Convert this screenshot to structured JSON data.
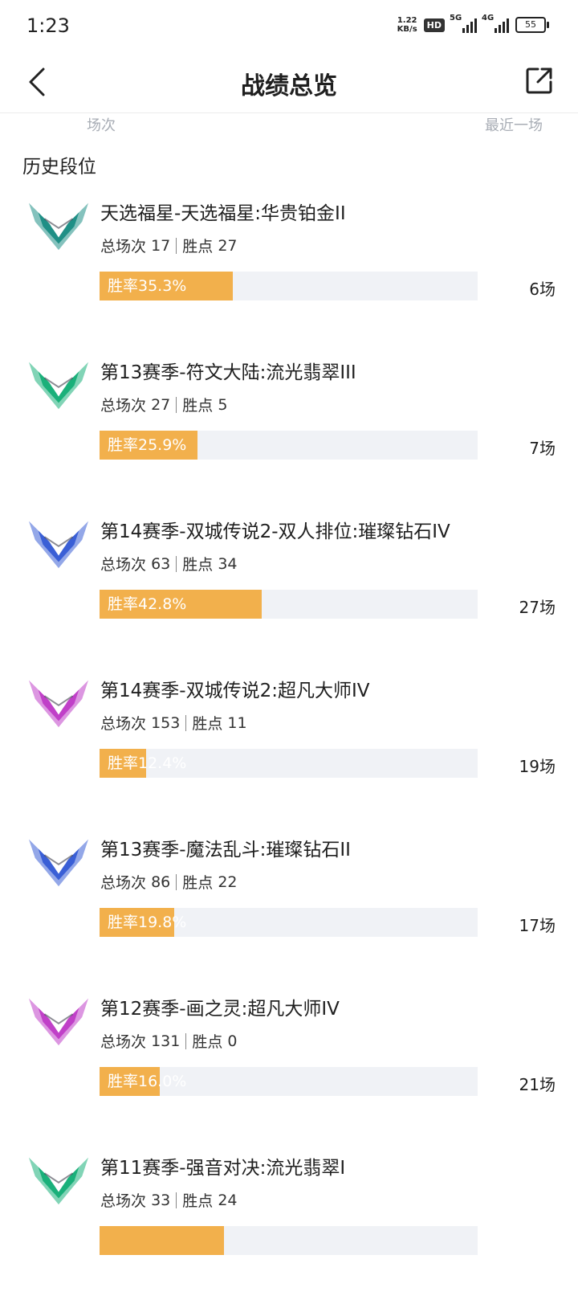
{
  "status_bar": {
    "time": "1:23",
    "net_speed_value": "1.22",
    "net_speed_unit": "KB/s",
    "hd_badge": "HD",
    "signal1_label": "5G",
    "signal2_label": "4G",
    "battery": "55"
  },
  "nav": {
    "title": "战绩总览",
    "back_icon": "chevron-left-icon",
    "share_icon": "share-external-icon"
  },
  "sub_header": {
    "left": "场次",
    "right": "最近一场"
  },
  "section_title": "历史段位",
  "colors": {
    "accent_orange": "#f2b04c",
    "track_gray": "#f0f2f6",
    "emerald": "#1ab07a",
    "platinum": "#1f8f86",
    "diamond": "#3a5fd6",
    "master": "#c040c8"
  },
  "ranks": [
    {
      "name": "天选福星-天选福星:华贵铂金II",
      "total_label": "总场次",
      "total": "17",
      "points_label": "胜点",
      "points": "27",
      "rate_text": "胜率35.3%",
      "rate": 35.3,
      "count": "6场",
      "tier": "platinum"
    },
    {
      "name": "第13赛季-符文大陆:流光翡翠III",
      "total_label": "总场次",
      "total": "27",
      "points_label": "胜点",
      "points": "5",
      "rate_text": "胜率25.9%",
      "rate": 25.9,
      "count": "7场",
      "tier": "emerald"
    },
    {
      "name": "第14赛季-双城传说2-双人排位:璀璨钻石IV",
      "total_label": "总场次",
      "total": "63",
      "points_label": "胜点",
      "points": "34",
      "rate_text": "胜率42.8%",
      "rate": 42.8,
      "count": "27场",
      "tier": "diamond"
    },
    {
      "name": "第14赛季-双城传说2:超凡大师IV",
      "total_label": "总场次",
      "total": "153",
      "points_label": "胜点",
      "points": "11",
      "rate_text": "胜率12.4%",
      "rate": 12.4,
      "count": "19场",
      "tier": "master"
    },
    {
      "name": "第13赛季-魔法乱斗:璀璨钻石II",
      "total_label": "总场次",
      "total": "86",
      "points_label": "胜点",
      "points": "22",
      "rate_text": "胜率19.8%",
      "rate": 19.8,
      "count": "17场",
      "tier": "diamond"
    },
    {
      "name": "第12赛季-画之灵:超凡大师IV",
      "total_label": "总场次",
      "total": "131",
      "points_label": "胜点",
      "points": "0",
      "rate_text": "胜率16.0%",
      "rate": 16.0,
      "count": "21场",
      "tier": "master"
    },
    {
      "name": "第11赛季-强音对决:流光翡翠I",
      "total_label": "总场次",
      "total": "33",
      "points_label": "胜点",
      "points": "24",
      "rate_text": "",
      "rate": 33.0,
      "count": "",
      "tier": "emerald"
    }
  ]
}
